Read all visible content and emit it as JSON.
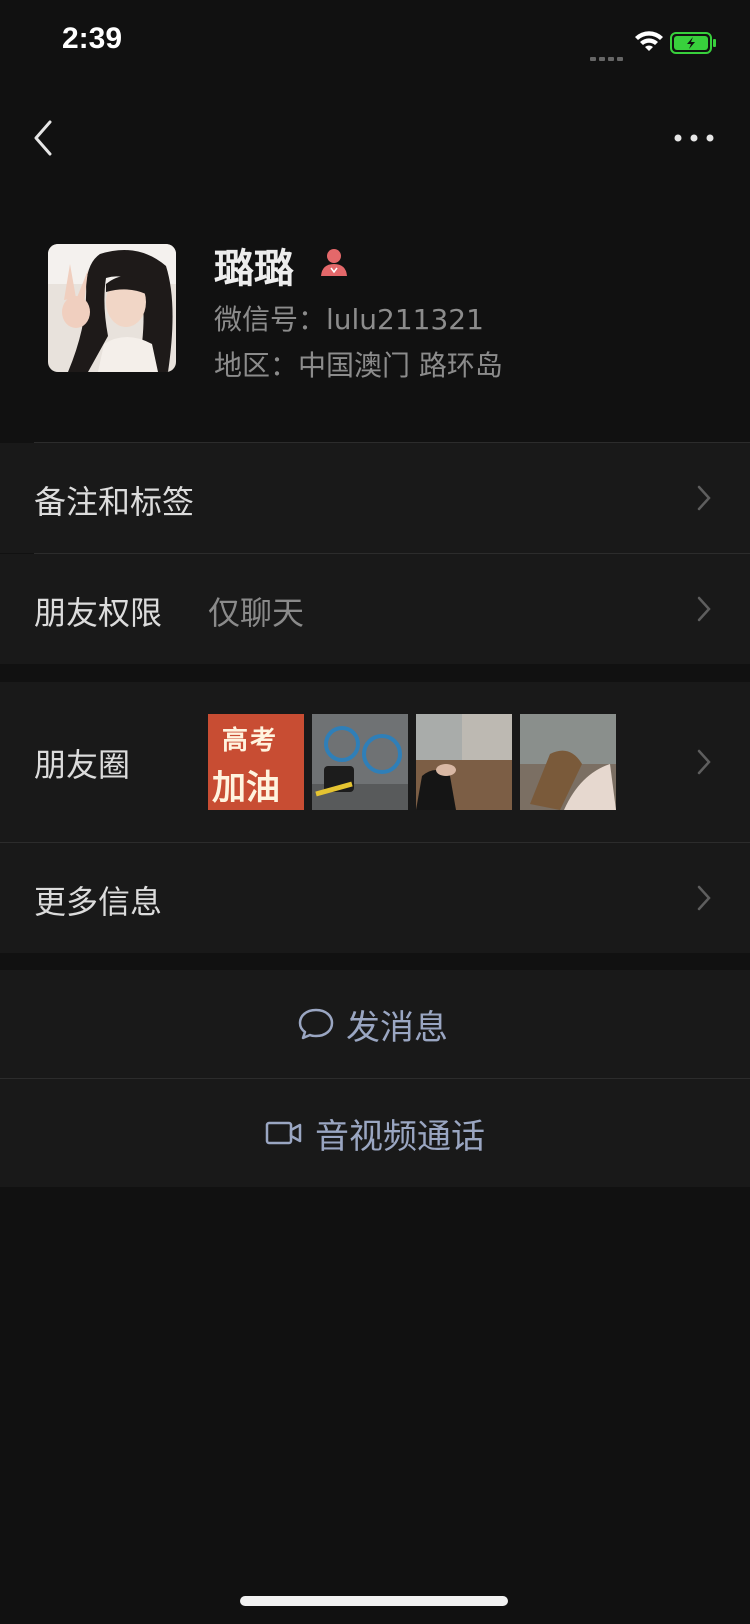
{
  "status_bar": {
    "time": "2:39"
  },
  "profile": {
    "name": "璐璐",
    "wechat_id": "微信号：lulu211321",
    "region": "地区：中国澳门 路环岛"
  },
  "rows": {
    "remarks_label": "备注和标签",
    "permissions_label": "朋友权限",
    "permissions_value": "仅聊天",
    "moments_label": "朋友圈",
    "more_info_label": "更多信息"
  },
  "moments_thumbnails": [
    {
      "text_line1": "高考",
      "text_line2": "加油"
    }
  ],
  "actions": {
    "send_message": "发消息",
    "video_call": "音视频通话"
  },
  "colors": {
    "background": "#111111",
    "cell": "#191919",
    "action_text": "#9aa6c2",
    "battery_green": "#38d03c",
    "female_icon": "#e4686a"
  }
}
